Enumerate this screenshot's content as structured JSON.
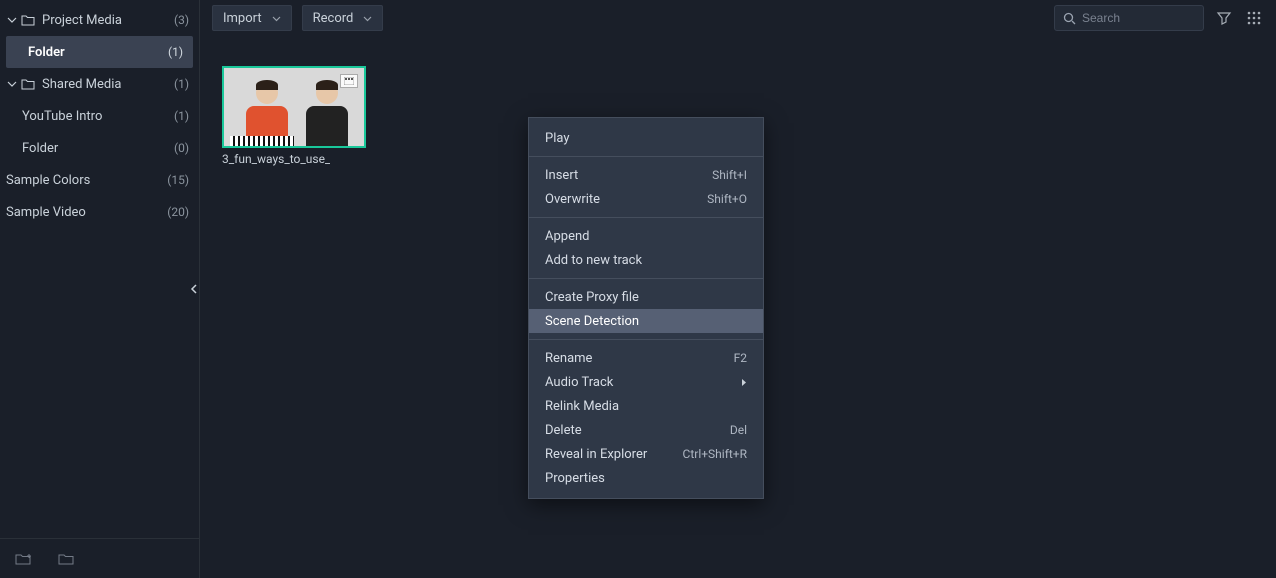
{
  "sidebar": {
    "items": [
      {
        "label": "Project Media",
        "count": "(3)",
        "hasChevron": true,
        "hasIcon": true
      },
      {
        "label": "Folder",
        "count": "(1)"
      },
      {
        "label": "Shared Media",
        "count": "(1)",
        "hasChevron": true,
        "hasIcon": true
      },
      {
        "label": "YouTube Intro",
        "count": "(1)"
      },
      {
        "label": "Folder",
        "count": "(0)"
      },
      {
        "label": "Sample Colors",
        "count": "(15)"
      },
      {
        "label": "Sample Video",
        "count": "(20)"
      }
    ]
  },
  "toolbar": {
    "import_label": "Import",
    "record_label": "Record",
    "search_placeholder": "Search"
  },
  "thumbnail": {
    "caption": "3_fun_ways_to_use_"
  },
  "context_menu": {
    "groups": [
      [
        {
          "label": "Play",
          "shortcut": ""
        }
      ],
      [
        {
          "label": "Insert",
          "shortcut": "Shift+I"
        },
        {
          "label": "Overwrite",
          "shortcut": "Shift+O"
        }
      ],
      [
        {
          "label": "Append",
          "shortcut": ""
        },
        {
          "label": "Add to new track",
          "shortcut": ""
        }
      ],
      [
        {
          "label": "Create Proxy file",
          "shortcut": ""
        },
        {
          "label": "Scene Detection",
          "shortcut": "",
          "hover": true
        }
      ],
      [
        {
          "label": "Rename",
          "shortcut": "F2"
        },
        {
          "label": "Audio Track",
          "shortcut": "",
          "submenu": true
        },
        {
          "label": "Relink Media",
          "shortcut": ""
        },
        {
          "label": "Delete",
          "shortcut": "Del"
        },
        {
          "label": "Reveal in Explorer",
          "shortcut": "Ctrl+Shift+R"
        },
        {
          "label": "Properties",
          "shortcut": ""
        }
      ]
    ]
  }
}
